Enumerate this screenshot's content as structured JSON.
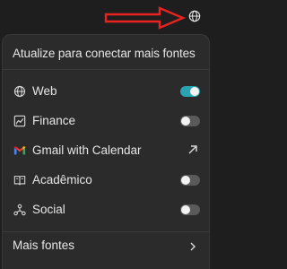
{
  "header": {
    "title": "Atualize para conectar mais fontes"
  },
  "sources": [
    {
      "label": "Web",
      "icon": "globe-icon",
      "control": "toggle",
      "enabled": true
    },
    {
      "label": "Finance",
      "icon": "chart-icon",
      "control": "toggle",
      "enabled": false
    },
    {
      "label": "Gmail with Calendar",
      "icon": "gmail-icon",
      "control": "external-link",
      "enabled": null
    },
    {
      "label": "Acadêmico",
      "icon": "book-icon",
      "control": "toggle",
      "enabled": false
    },
    {
      "label": "Social",
      "icon": "network-icon",
      "control": "toggle",
      "enabled": false
    }
  ],
  "footer": {
    "more_label": "Mais fontes"
  },
  "colors": {
    "accent": "#2aa3b3",
    "annotation_arrow": "#e8231f"
  }
}
